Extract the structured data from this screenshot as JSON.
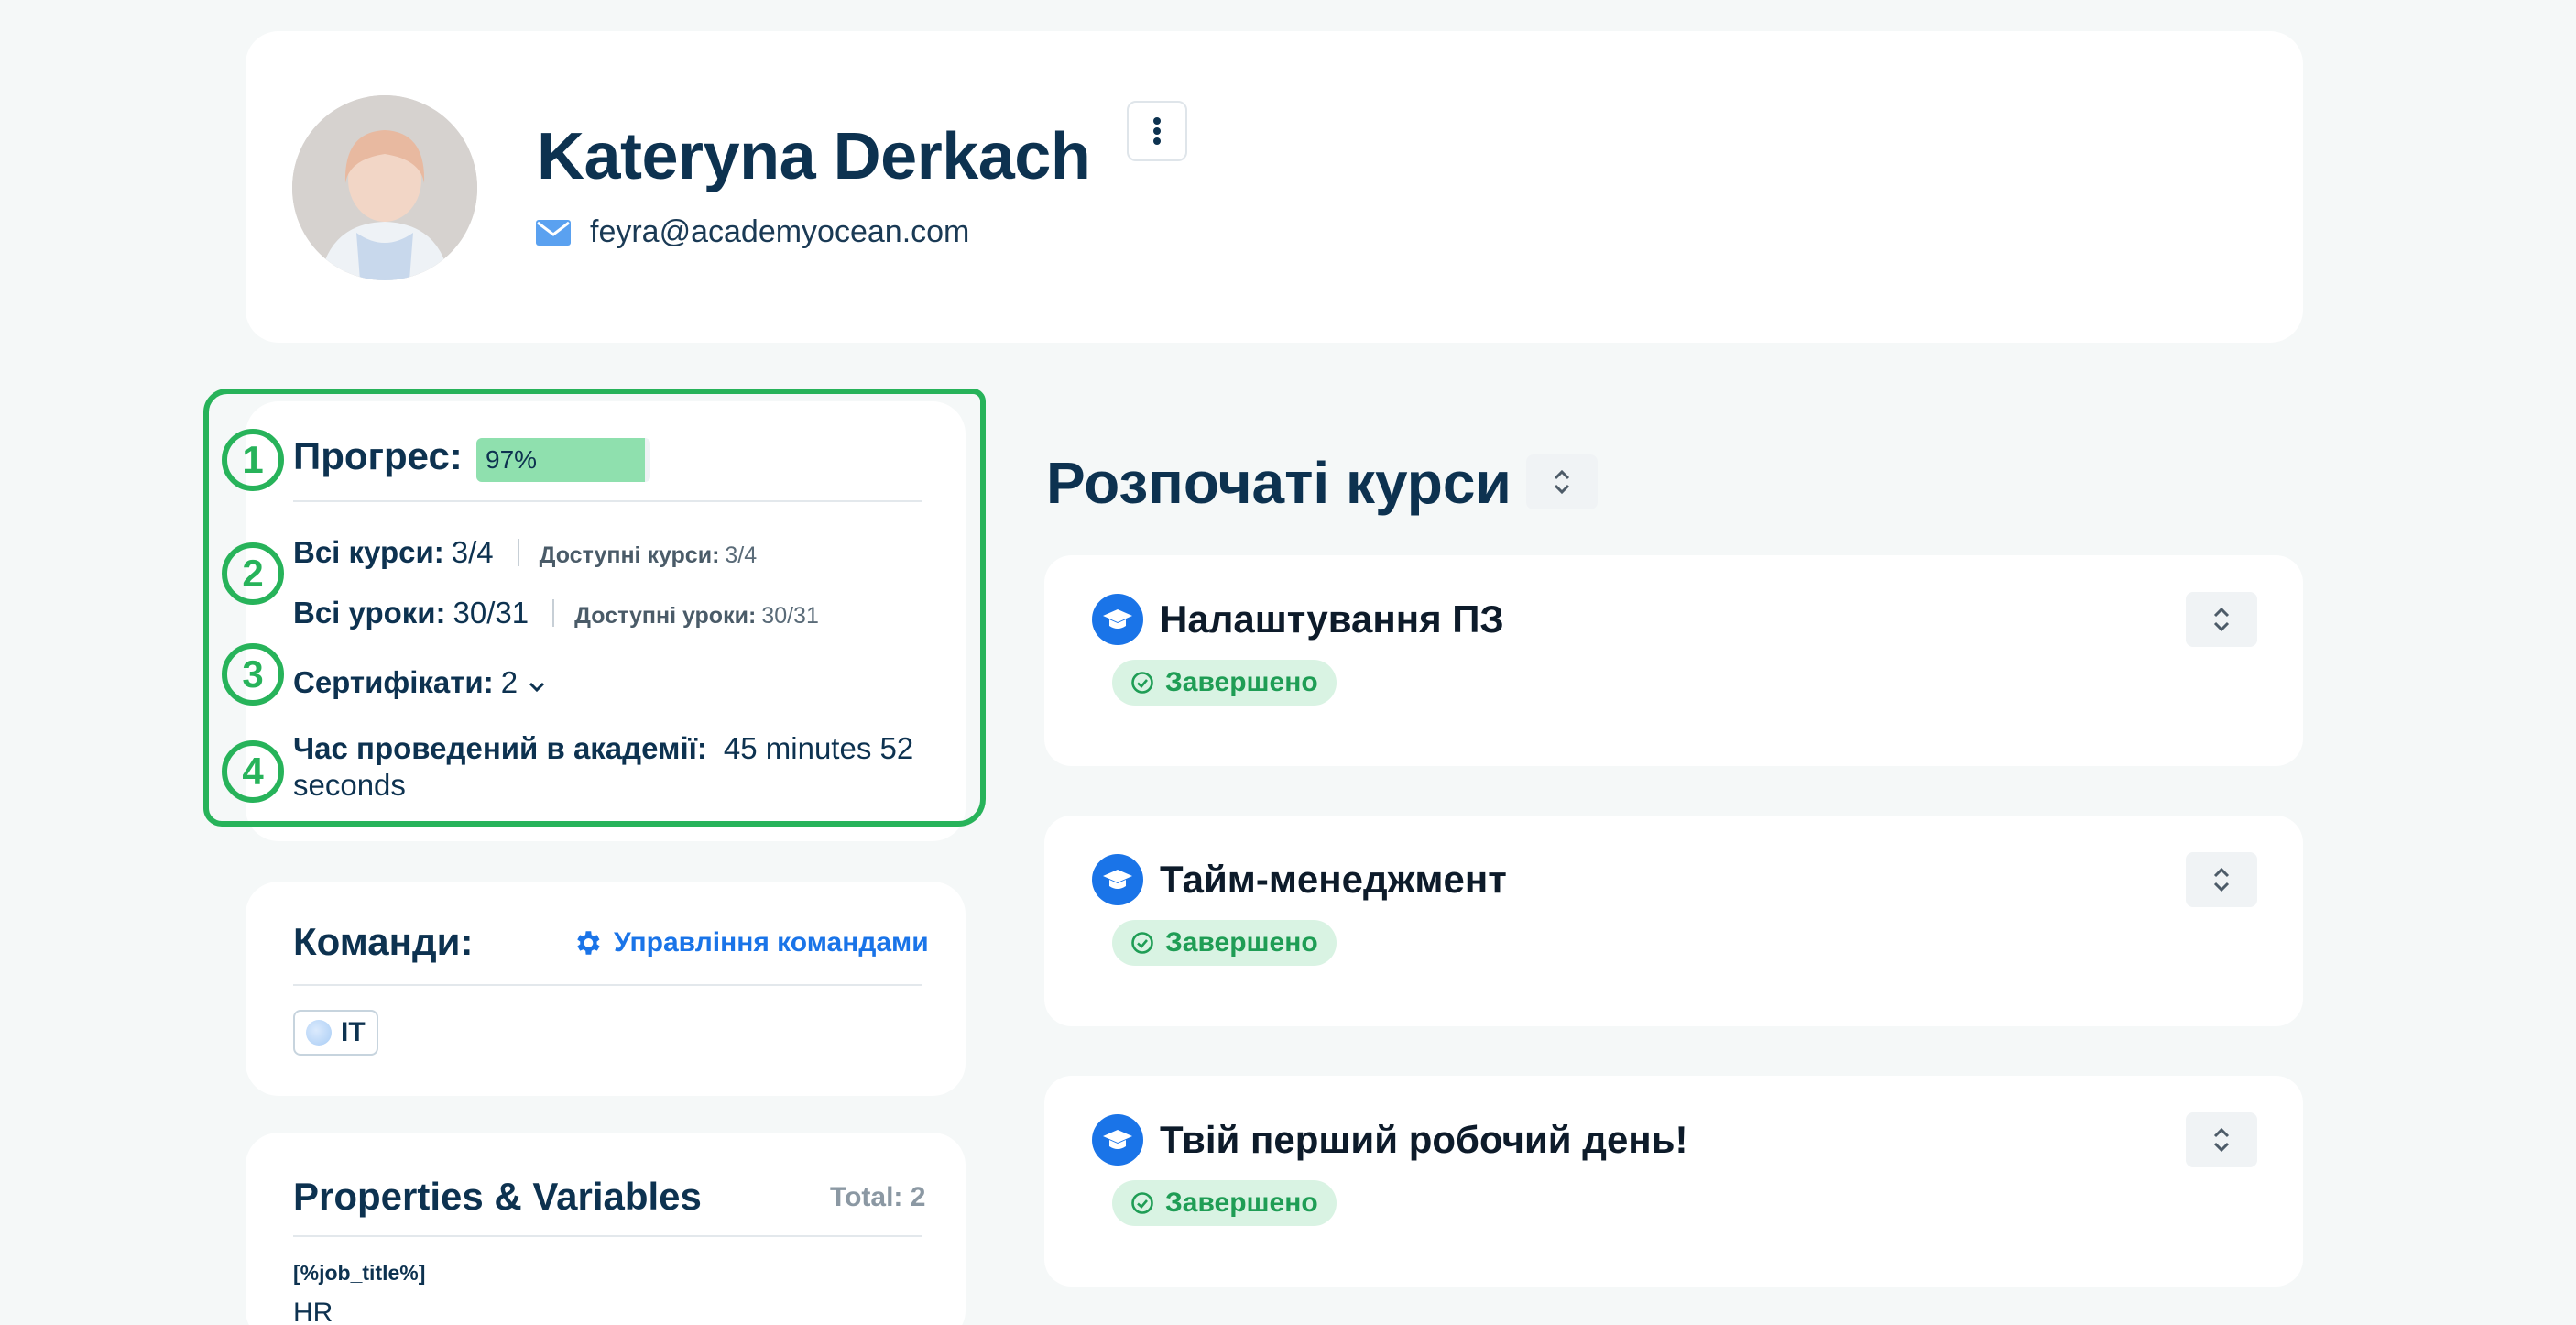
{
  "profile": {
    "name": "Kateryna Derkach",
    "email": "feyra@academyocean.com"
  },
  "stats": {
    "progress_label": "Прогрес:",
    "progress_value": "97%",
    "progress_fraction": 0.97,
    "all_courses_label": "Всі курси:",
    "all_courses_value": "3/4",
    "available_courses_label": "Доступні курси:",
    "available_courses_value": "3/4",
    "all_lessons_label": "Всі уроки:",
    "all_lessons_value": "30/31",
    "available_lessons_label": "Доступні уроки:",
    "available_lessons_value": "30/31",
    "certificates_label": "Сертифікати:",
    "certificates_value": "2",
    "time_label": "Час проведений в академії:",
    "time_value_line1": "45 minutes 52",
    "time_value_line2": "seconds"
  },
  "annotations": [
    "1",
    "2",
    "3",
    "4"
  ],
  "teams": {
    "title": "Команди:",
    "manage_label": "Управління командами",
    "items": [
      {
        "name": "IT"
      }
    ]
  },
  "properties": {
    "title": "Properties & Variables",
    "total": "Total: 2",
    "items": [
      {
        "key": "[%job_title%]",
        "value": "HR"
      }
    ]
  },
  "courses": {
    "title": "Розпочаті курси",
    "items": [
      {
        "title": "Налаштування ПЗ",
        "status": "Завершено"
      },
      {
        "title": "Тайм-менеджмент",
        "status": "Завершено"
      },
      {
        "title": "Твій перший робочий день!",
        "status": "Завершено"
      }
    ]
  },
  "colors": {
    "accent": "#1a74e8",
    "progress_fill": "#8fe0ae",
    "status_bg": "#d9f3e3",
    "status_text": "#1f9d55",
    "highlight": "#27b35a"
  },
  "icons": [
    "mail-icon",
    "kebab-menu-icon",
    "chevron-down-icon",
    "gear-icon",
    "graduation-cap-icon",
    "check-circle-icon",
    "sort-icon"
  ]
}
